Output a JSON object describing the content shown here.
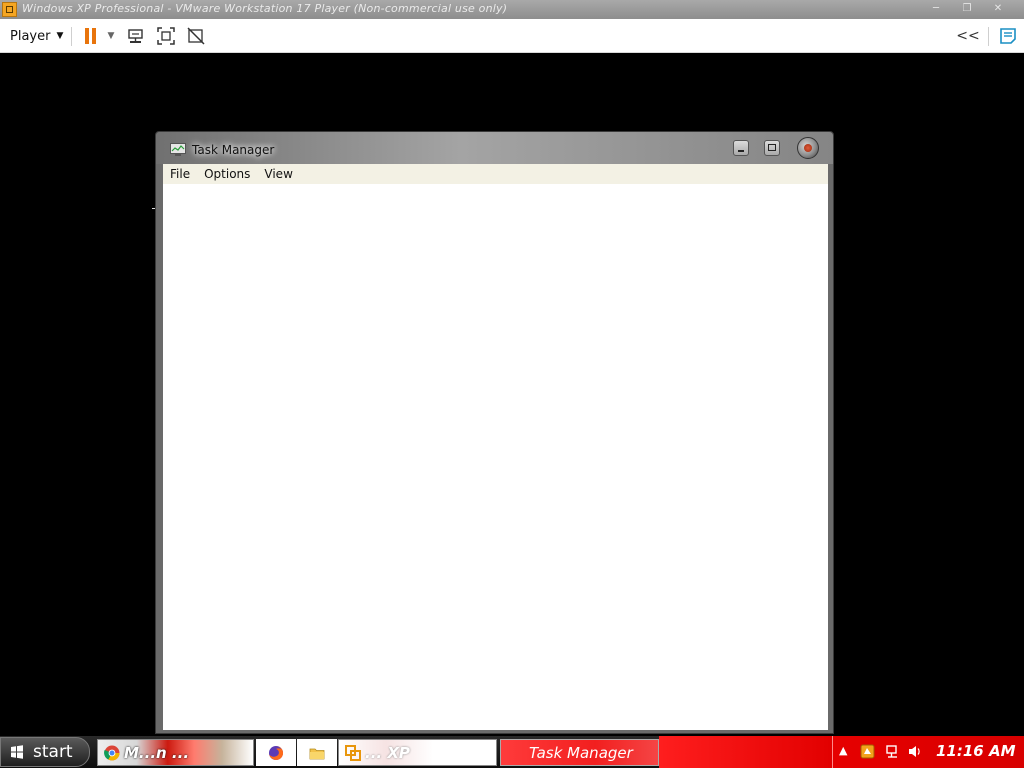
{
  "host_window": {
    "title": "Windows XP Professional - VMware Workstation 17 Player (Non-commercial use only)"
  },
  "player_toolbar": {
    "player_menu_label": "Player",
    "pause_icon": "pause-icon",
    "send_keys_icon": "send-ctrl-alt-del-icon",
    "fullscreen_icon": "fullscreen-icon",
    "unity_icon": "unity-icon",
    "collapse_icon": "double-chevron-left-icon",
    "notes_icon": "notes-icon",
    "collapse_glyph": "<<"
  },
  "task_manager": {
    "title": "Task Manager",
    "menu": [
      "File",
      "Options",
      "View"
    ]
  },
  "taskbar": {
    "start_label": "start",
    "tasks": {
      "chrome_label": "M...n ...",
      "vmware_label": "... XP",
      "taskmgr_label": "Task Manager"
    },
    "clock": "11:16 AM"
  },
  "colors": {
    "pause_accent": "#e8740c",
    "taskbar_red": "#e60000",
    "menu_bar_bg": "#f3f1e4"
  }
}
